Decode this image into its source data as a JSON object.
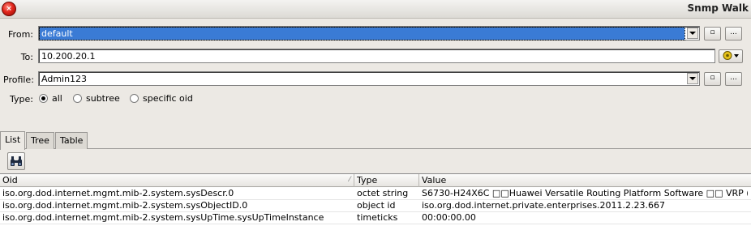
{
  "window": {
    "title": "Snmp Walk"
  },
  "form": {
    "from_label": "From:",
    "from_value": "default",
    "to_label": "To:",
    "to_value": "10.200.20.1",
    "profile_label": "Profile:",
    "profile_value": "Admin123",
    "type_label": "Type:",
    "type_options": [
      "all",
      "subtree",
      "specific oid"
    ],
    "type_selected": "all",
    "small_btn_label": "...",
    "ellipsis_label": "..."
  },
  "tabs": [
    "List",
    "Tree",
    "Table"
  ],
  "active_tab": "List",
  "table": {
    "columns": [
      "Oid",
      "Type",
      "Value"
    ],
    "rows": [
      {
        "oid": "iso.org.dod.internet.mgmt.mib-2.system.sysDescr.0",
        "type": "octet string",
        "value": "S6730-H24X6C □□Huawei Versatile Routing Platform Software □□ VRP (..."
      },
      {
        "oid": "iso.org.dod.internet.mgmt.mib-2.system.sysObjectID.0",
        "type": "object id",
        "value": "iso.org.dod.internet.private.enterprises.2011.2.23.667"
      },
      {
        "oid": "iso.org.dod.internet.mgmt.mib-2.system.sysUpTime.sysUpTimeInstance",
        "type": "timeticks",
        "value": "00:00:00.00"
      }
    ]
  },
  "colors": {
    "selection": "#3a7bd5",
    "window_bg": "#ece9e4"
  }
}
